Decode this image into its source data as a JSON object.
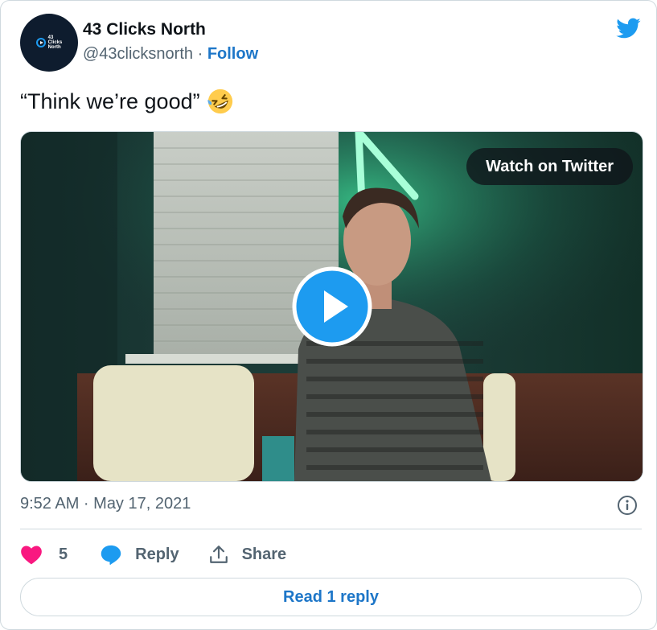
{
  "author": {
    "name": "43 Clicks North",
    "handle": "@43clicksnorth",
    "separator": " · ",
    "follow_label": "Follow",
    "avatar_text": [
      "43",
      "Clicks",
      "North"
    ]
  },
  "tweet": {
    "text": "“Think we’re good”",
    "emoji": "🤣"
  },
  "media": {
    "watch_label": "Watch on Twitter",
    "play_icon": "play-icon"
  },
  "meta": {
    "timestamp": "9:52 AM · May 17, 2021"
  },
  "actions": {
    "like_count": "5",
    "reply_label": "Reply",
    "share_label": "Share"
  },
  "footer": {
    "read_replies_label": "Read 1 reply"
  },
  "colors": {
    "brand_blue": "#1d9bf0",
    "link_blue": "#1d76c8",
    "heart": "#f91880",
    "text_secondary": "#536471",
    "border": "#cfd9de"
  }
}
